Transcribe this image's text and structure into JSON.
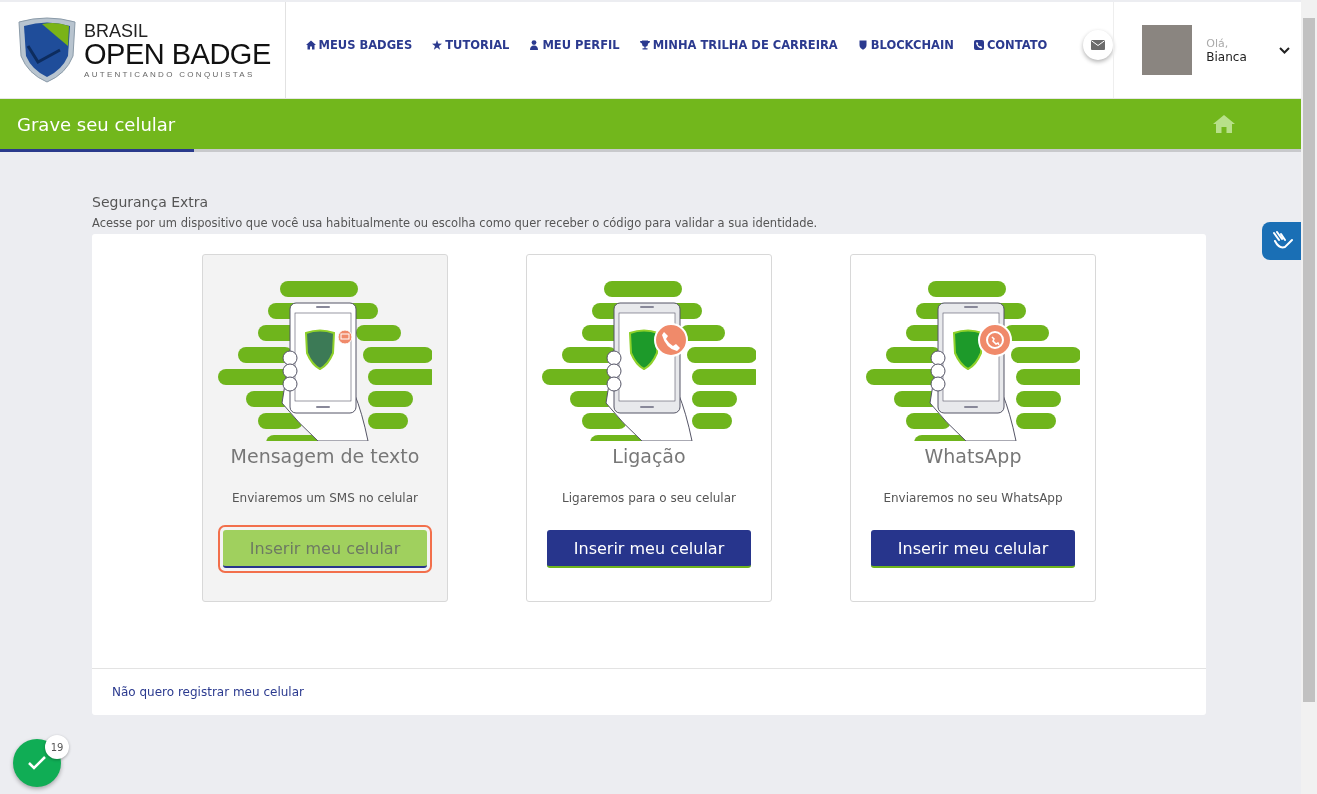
{
  "logo": {
    "line1": "BRASIL",
    "line2": "OPEN BADGE",
    "tagline": "AUTENTICANDO CONQUISTAS"
  },
  "nav": [
    {
      "label": "MEUS BADGES",
      "kind": "home"
    },
    {
      "label": "TUTORIAL",
      "kind": "star"
    },
    {
      "label": "MEU PERFIL",
      "kind": "user"
    },
    {
      "label": "MINHA TRILHA DE CARREIRA",
      "kind": "trophy"
    },
    {
      "label": "BLOCKCHAIN",
      "kind": "shield"
    },
    {
      "label": "CONTATO",
      "kind": "phone"
    }
  ],
  "user": {
    "greeting": "Olá,",
    "name": "Bianca"
  },
  "page_title": "Grave seu celular",
  "section": {
    "title": "Segurança Extra",
    "description": "Acesse por um dispositivo que você usa habitualmente ou escolha como quer receber o código para validar a sua identidade."
  },
  "options": [
    {
      "kind": "sms",
      "title": "Mensagem de texto",
      "description": "Enviaremos um SMS no celular",
      "button": "Inserir meu celular",
      "selected": true
    },
    {
      "kind": "call",
      "title": "Ligação",
      "description": "Ligaremos para o seu celular",
      "button": "Inserir meu celular",
      "selected": false
    },
    {
      "kind": "whatsapp",
      "title": "WhatsApp",
      "description": "Enviaremos no seu WhatsApp",
      "button": "Inserir meu celular",
      "selected": false
    }
  ],
  "skip_link": "Não quero registrar meu celular",
  "notification_count": "19"
}
